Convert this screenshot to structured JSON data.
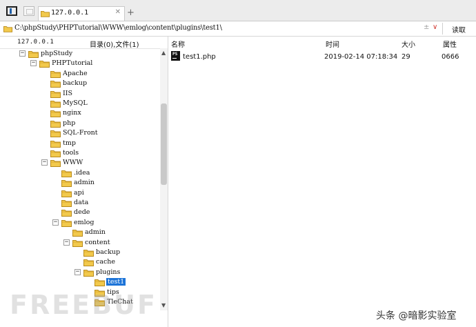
{
  "tab": {
    "title": "127.0.0.1",
    "close": "✕",
    "new_tab": "+"
  },
  "address": {
    "path": "C:\\phpStudy\\PHPTutorial\\WWW\\emlog\\content\\plugins\\test1\\",
    "read_label": "读取",
    "dropdown_a": "±",
    "dropdown_b": "∨"
  },
  "left_header": {
    "host": "127.0.0.1",
    "counts": "目录(0),文件(1)"
  },
  "tree": [
    {
      "label": "phpStudy",
      "level": 0,
      "expanded": true
    },
    {
      "label": "PHPTutorial",
      "level": 1,
      "expanded": true
    },
    {
      "label": "Apache",
      "level": 2
    },
    {
      "label": "backup",
      "level": 2
    },
    {
      "label": "IIS",
      "level": 2
    },
    {
      "label": "MySQL",
      "level": 2
    },
    {
      "label": "nginx",
      "level": 2
    },
    {
      "label": "php",
      "level": 2
    },
    {
      "label": "SQL-Front",
      "level": 2
    },
    {
      "label": "tmp",
      "level": 2
    },
    {
      "label": "tools",
      "level": 2
    },
    {
      "label": "WWW",
      "level": 2,
      "expanded": true
    },
    {
      "label": ".idea",
      "level": 3
    },
    {
      "label": "admin",
      "level": 3
    },
    {
      "label": "api",
      "level": 3
    },
    {
      "label": "data",
      "level": 3
    },
    {
      "label": "dede",
      "level": 3
    },
    {
      "label": "emlog",
      "level": 3,
      "expanded": true
    },
    {
      "label": "admin",
      "level": 4
    },
    {
      "label": "content",
      "level": 4,
      "expanded": true
    },
    {
      "label": "backup",
      "level": 5
    },
    {
      "label": "cache",
      "level": 5
    },
    {
      "label": "plugins",
      "level": 5,
      "expanded": true
    },
    {
      "label": "test1",
      "level": 6,
      "selected": true
    },
    {
      "label": "tips",
      "level": 6
    },
    {
      "label": "TleChat",
      "level": 6
    }
  ],
  "columns": {
    "name": "名称",
    "time": "时间",
    "size": "大小",
    "attr": "属性"
  },
  "files": [
    {
      "name": "test1.php",
      "time": "2019-02-14 07:18:34",
      "size": "29",
      "attr": "0666",
      "icon": "phpstorm-file-icon"
    }
  ],
  "watermark": "FREEBUF",
  "credit": "头条 @暗影实验室",
  "colors": {
    "selection": "#1d74d8",
    "folder": "#f2c94c",
    "folder_edge": "#b88a1b",
    "window_blue": "#1f5fa8"
  }
}
